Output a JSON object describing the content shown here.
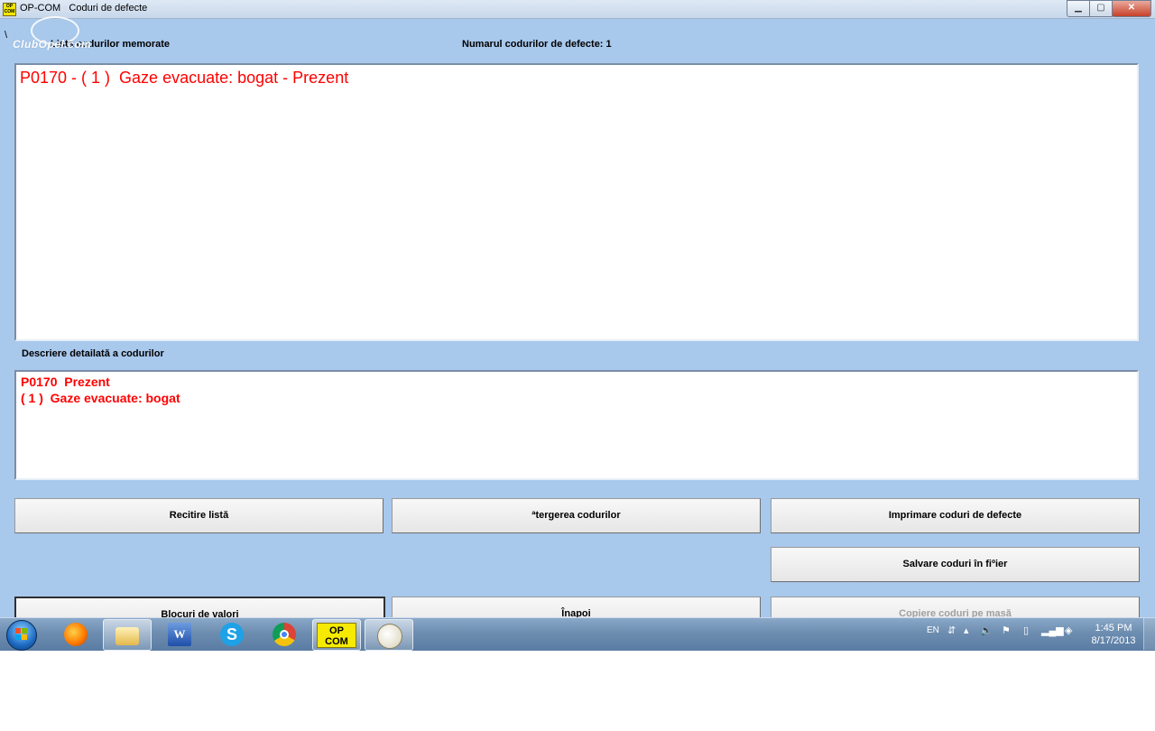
{
  "window": {
    "app_name": "OP-COM",
    "title": "Coduri de defecte",
    "app_icon_text": "OP COM"
  },
  "watermark": {
    "text": "ClubOpel.com"
  },
  "header": {
    "list_label": "Lista codurilor memorate",
    "count_label": "Numarul codurilor de defecte: 1"
  },
  "codes_list": {
    "items": [
      "P0170 - ( 1 )  Gaze evacuate: bogat - Prezent"
    ]
  },
  "detail": {
    "label": "Descriere detailată a codurilor",
    "lines": [
      "P0170  Prezent",
      "( 1 )  Gaze evacuate: bogat"
    ]
  },
  "buttons": {
    "reread": "Recitire listă",
    "clear": "ªtergerea codurilor",
    "print": "Imprimare coduri de defecte",
    "save": "Salvare coduri în fiºier",
    "blocks": "Blocuri de valori",
    "back": "Înapoi",
    "copy": "Copiere coduri pe masă"
  },
  "taskbar": {
    "opcom_label": "OP COM",
    "word_label": "W",
    "skype_label": "S",
    "language": "EN",
    "time": "1:45 PM",
    "date": "8/17/2013"
  },
  "colors": {
    "window_bg": "#a8c8ec",
    "code_text": "#ff0000",
    "taskbar": "#6d8db0"
  }
}
